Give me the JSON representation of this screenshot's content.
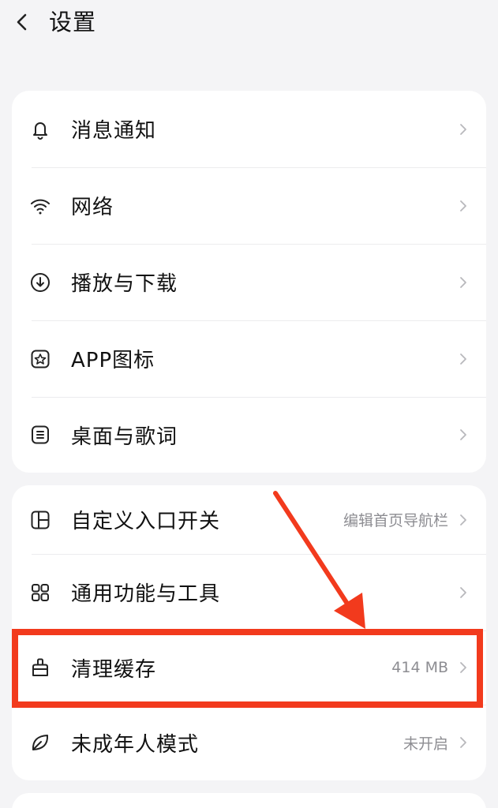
{
  "header": {
    "title": "设置",
    "back_icon": "chevron-left-icon"
  },
  "group1": {
    "items": [
      {
        "label": "消息通知",
        "icon": "bell-icon"
      },
      {
        "label": "网络",
        "icon": "wifi-icon"
      },
      {
        "label": "播放与下载",
        "icon": "download-icon"
      },
      {
        "label": "APP图标",
        "icon": "app-icon"
      },
      {
        "label": "桌面与歌词",
        "icon": "lyrics-icon"
      }
    ]
  },
  "group2": {
    "items": [
      {
        "label": "自定义入口开关",
        "value": "编辑首页导航栏",
        "icon": "layout-icon"
      },
      {
        "label": "通用功能与工具",
        "value": "",
        "icon": "grid-icon"
      },
      {
        "label": "清理缓存",
        "value": "414 MB",
        "icon": "broom-icon"
      },
      {
        "label": "未成年人模式",
        "value": "未开启",
        "icon": "leaf-icon"
      }
    ]
  },
  "annotation": {
    "color": "#f23a1d"
  }
}
